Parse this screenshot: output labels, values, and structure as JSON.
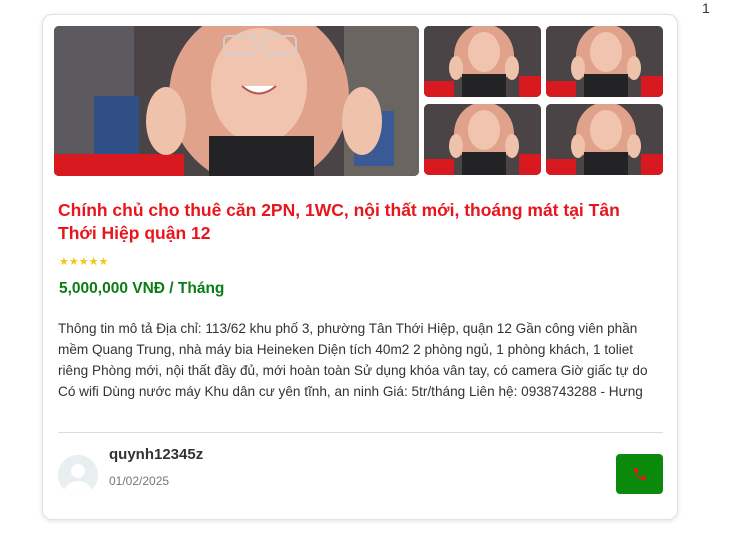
{
  "page_number": "1",
  "listing": {
    "title": "Chính chủ cho thuê căn 2PN, 1WC, nội thất mới, thoáng mát tại Tân Thới Hiệp quận 12",
    "rating_stars": "★★★★★",
    "rating": 5,
    "price": "5,000,000 VNĐ / Tháng",
    "description": "Thông tin mô tả Địa chỉ: 113/62 khu phố 3, phường Tân Thới Hiệp, quận 12 Gần công viên phần mềm Quang Trung, nhà máy bia Heineken Diện tích 40m2 2 phòng ngủ, 1 phòng khách, 1 toliet riêng Phòng mới, nội thất đầy đủ, mới hoàn toàn Sử dụng khóa vân tay, có camera Giờ giấc tự do Có wifi Dùng nước máy Khu dân cư yên tĩnh, an ninh Giá: 5tr/tháng Liên hệ: 0938743288 - Hưng"
  },
  "poster": {
    "username": "quynh12345z",
    "date": "01/02/2025"
  },
  "icons": {
    "call": "phone-icon",
    "avatar": "user-avatar-icon"
  },
  "colors": {
    "title": "#e8161c",
    "price": "#0b7d16",
    "call_button": "#0a8a0a",
    "phone_icon": "#e8161c",
    "stars": "#f5c518"
  }
}
